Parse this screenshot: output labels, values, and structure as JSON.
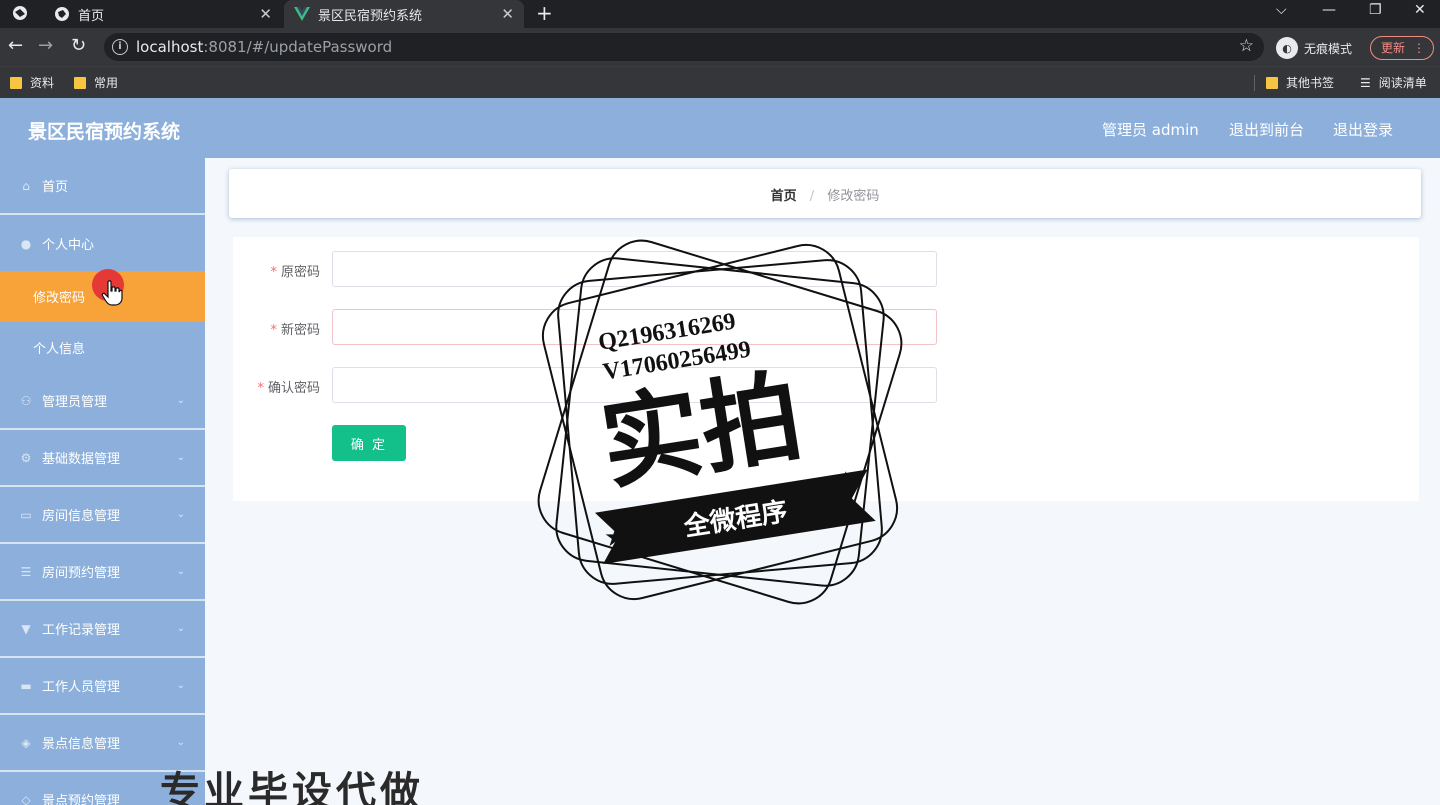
{
  "browser": {
    "tabs": [
      {
        "title": "首页",
        "active": false
      },
      {
        "title": "景区民宿预约系统",
        "active": true
      }
    ],
    "url_host": "localhost",
    "url_rest": ":8081/#/updatePassword",
    "incognito_label": "无痕模式",
    "update_label": "更新",
    "bookmarks": [
      "资料",
      "常用"
    ],
    "other_bookmarks": "其他书签",
    "reading_list": "阅读清单"
  },
  "header": {
    "title": "景区民宿预约系统",
    "admin": "管理员 admin",
    "exit_front": "退出到前台",
    "logout": "退出登录"
  },
  "sidebar": {
    "home": "首页",
    "personal_center": "个人中心",
    "sub_change_password": "修改密码",
    "sub_personal_info": "个人信息",
    "menus": [
      "管理员管理",
      "基础数据管理",
      "房间信息管理",
      "房间预约管理",
      "工作记录管理",
      "工作人员管理",
      "景点信息管理",
      "景点预约管理"
    ]
  },
  "breadcrumb": {
    "home": "首页",
    "separator": "/",
    "current": "修改密码"
  },
  "form": {
    "required_mark": "*",
    "old_password_label": "原密码",
    "new_password_label": "新密码",
    "confirm_password_label": "确认密码",
    "old_password_value": "",
    "new_password_value": "",
    "confirm_password_value": "",
    "confirm_button": "确 定"
  },
  "watermark": {
    "line1": "Q2196316269",
    "line2": "V17060256499",
    "big": "实拍",
    "ribbon": "全微程序",
    "bottom": "专业毕设代做"
  },
  "colors": {
    "accent": "#8cb0db",
    "active_menu": "#f7a33a",
    "confirm_button": "#14c08a",
    "required": "#f56c6c"
  }
}
